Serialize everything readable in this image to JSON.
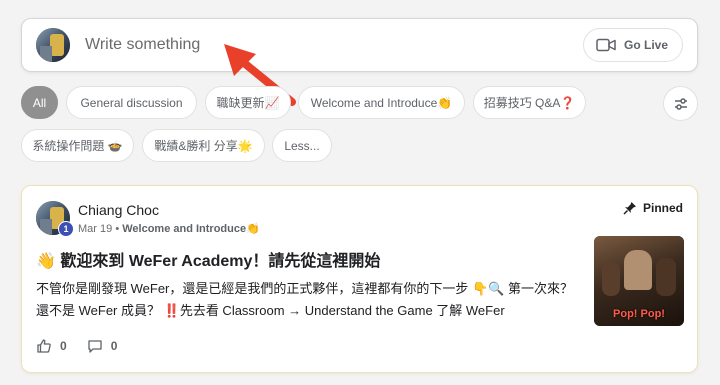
{
  "composer": {
    "placeholder": "Write something",
    "go_live_label": "Go Live"
  },
  "categories": {
    "chips": [
      {
        "label": "All",
        "active": true
      },
      {
        "label": "General discussion",
        "active": false
      },
      {
        "label": "職缺更新📈",
        "active": false
      },
      {
        "label": "Welcome and Introduce👏",
        "active": false
      },
      {
        "label": "招募技巧 Q&A❓",
        "active": false
      },
      {
        "label": "系統操作問題 🍲",
        "active": false
      },
      {
        "label": "戰績&勝利 分享🌟",
        "active": false
      },
      {
        "label": "Less...",
        "active": false
      }
    ]
  },
  "post": {
    "author": "Chiang Choc",
    "level": "1",
    "date": "Mar 19",
    "separator": "•",
    "category": "Welcome and Introduce👏",
    "pinned_label": "Pinned",
    "title": "👋 歡迎來到 WeFer Academy！請先從這裡開始",
    "body_part1": "不管你是剛發現 WeFer，還是已經是我們的正式夥伴，這裡都有你的下一步 👇🔍 第一次來？還不是 WeFer 成員？",
    "body_emphasis": "‼️",
    "body_part2": "先去看 Classroom → Understand the Game 了解 WeFer",
    "thumbnail_caption": "Pop! Pop!",
    "likes": "0",
    "comments": "0"
  },
  "colors": {
    "accent_active_chip": "#909090",
    "arrow": "#e8402a",
    "level_badge": "#3b4fb5",
    "pinned_border": "#f0e2b6"
  }
}
